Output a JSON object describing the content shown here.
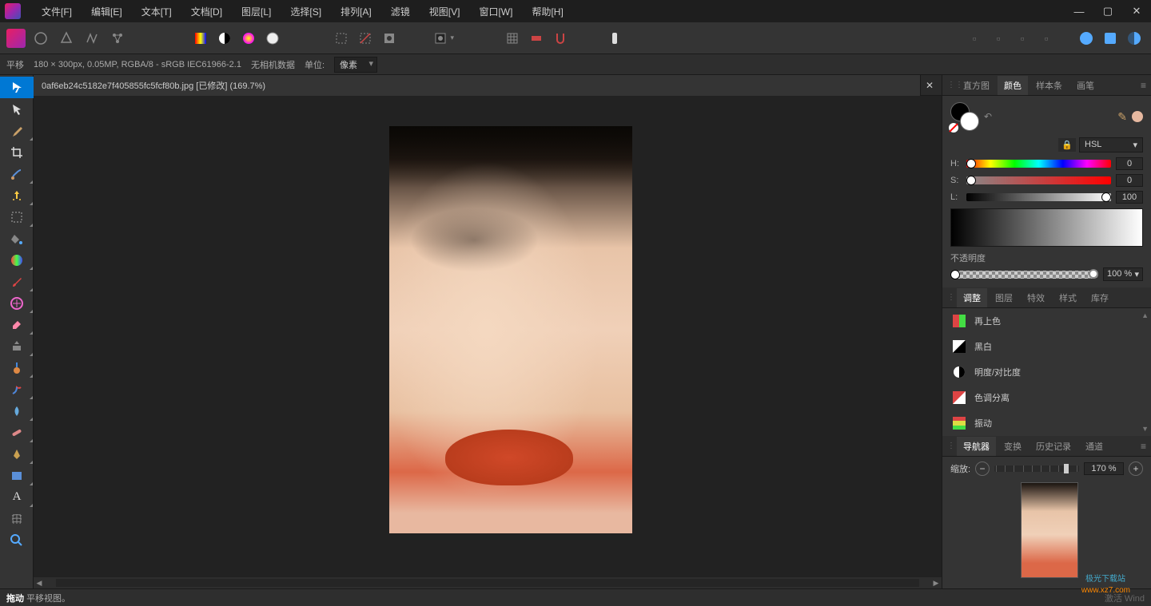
{
  "menubar": {
    "items": [
      "文件[F]",
      "编辑[E]",
      "文本[T]",
      "文档[D]",
      "图层[L]",
      "选择[S]",
      "排列[A]",
      "滤镜",
      "视图[V]",
      "窗口[W]",
      "帮助[H]"
    ]
  },
  "contextbar": {
    "tool_name": "平移",
    "doc_info": "180 × 300px, 0.05MP, RGBA/8 - sRGB IEC61966-2.1",
    "camera": "无相机数据",
    "unit_label": "单位:",
    "unit_value": "像素"
  },
  "document_tab": {
    "title": "0af6eb24c5182e7f405855fc5fcf80b.jpg [已修改] (169.7%)"
  },
  "color_panel": {
    "tabs": [
      "直方图",
      "颜色",
      "样本条",
      "画笔"
    ],
    "active_tab": "颜色",
    "mode": "HSL",
    "h_label": "H:",
    "s_label": "S:",
    "l_label": "L:",
    "h_value": "0",
    "s_value": "0",
    "l_value": "100",
    "opacity_label": "不透明度",
    "opacity_value": "100 %"
  },
  "adjust_panel": {
    "tabs": [
      "调整",
      "图层",
      "特效",
      "样式",
      "库存"
    ],
    "active_tab": "调整",
    "items": [
      "再上色",
      "黑白",
      "明度/对比度",
      "色调分离",
      "振动"
    ]
  },
  "nav_panel": {
    "tabs": [
      "导航器",
      "变换",
      "历史记录",
      "通道"
    ],
    "active_tab": "导航器",
    "zoom_label": "缩放:",
    "zoom_value": "170 %"
  },
  "statusbar": {
    "action": "拖动",
    "hint": "平移视图。",
    "watermark": "激活 Wind"
  },
  "watermark_logo1": "极光下载站",
  "watermark_logo2": "www.xz7.com"
}
